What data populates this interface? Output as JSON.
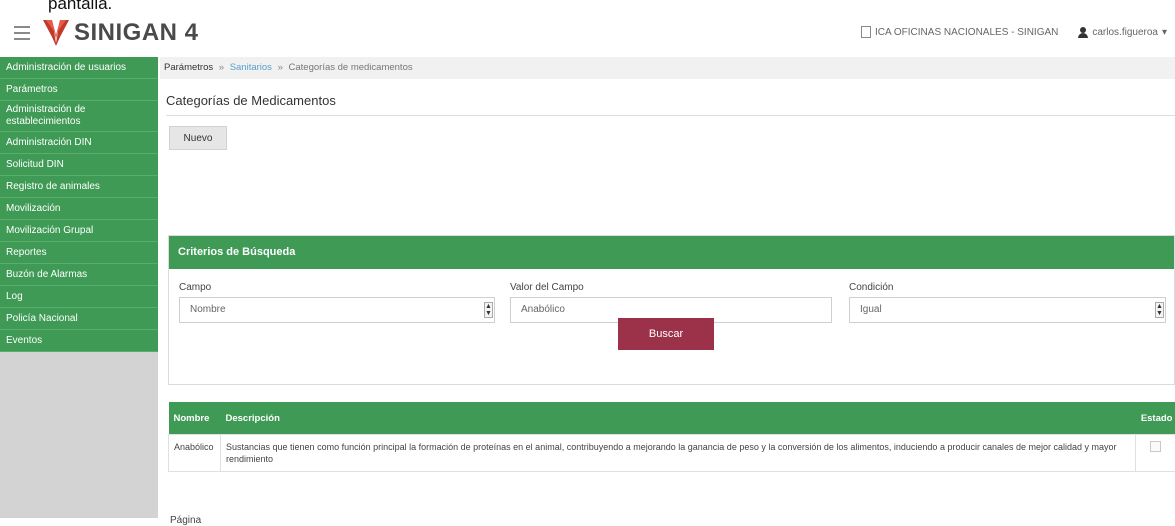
{
  "top_caption": "pantalla.",
  "header": {
    "brand": "SINIGAN 4",
    "org": "ICA OFICINAS NACIONALES - SINIGAN",
    "user": "carlos.figueroa"
  },
  "sidebar": {
    "items": [
      {
        "label": "Administración de usuarios"
      },
      {
        "label": "Parámetros"
      },
      {
        "label": "Administración de establecimientos"
      },
      {
        "label": "Administración DIN"
      },
      {
        "label": "Solicitud DIN"
      },
      {
        "label": "Registro de animales"
      },
      {
        "label": "Movilización"
      },
      {
        "label": "Movilización Grupal"
      },
      {
        "label": "Reportes"
      },
      {
        "label": "Buzón de Alarmas"
      },
      {
        "label": "Log"
      },
      {
        "label": "Policía Nacional"
      },
      {
        "label": "Eventos"
      }
    ]
  },
  "breadcrumb": {
    "root": "Parámetros",
    "sep1": "»",
    "mid": "Sanitarios",
    "sep2": "»",
    "current": "Categorías de medicamentos"
  },
  "page_title": "Categorías de Medicamentos",
  "new_button": "Nuevo",
  "search": {
    "panel_title": "Criterios de Búsqueda",
    "campo_label": "Campo",
    "campo_value": "Nombre",
    "valor_label": "Valor del Campo",
    "valor_value": "Anabólico",
    "condicion_label": "Condición",
    "condicion_value": "Igual",
    "button": "Buscar"
  },
  "results": {
    "columns": [
      "Nombre",
      "Descripción",
      "Estado"
    ],
    "rows": [
      {
        "nombre": "Anabólico",
        "descripcion": "Sustancias que tienen como función principal la formación de proteínas en el animal, contribuyendo a mejorando la ganancia de peso y la conversión de los alimentos, induciendo a producir canales de mejor calidad y mayor rendimiento"
      }
    ]
  },
  "pager": "Página",
  "colors": {
    "green": "#3e9a54",
    "buscar": "#9b3249",
    "logo_red": "#c0392b"
  }
}
